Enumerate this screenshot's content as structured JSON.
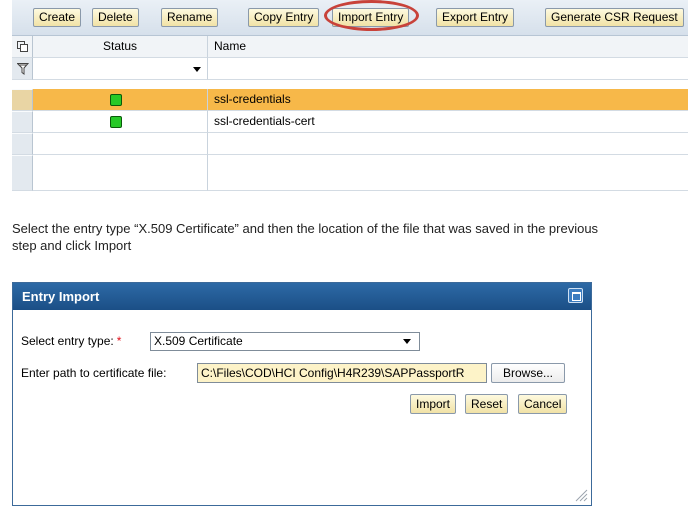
{
  "toolbar": {
    "buttons": [
      {
        "label": "Create"
      },
      {
        "label": "Delete"
      },
      {
        "label": "Rename"
      },
      {
        "label": "Copy Entry"
      },
      {
        "label": "Import Entry",
        "highlighted": true
      },
      {
        "label": "Export Entry"
      },
      {
        "label": "Generate CSR Request"
      }
    ],
    "highlight_color": "#c8423a"
  },
  "table": {
    "columns": {
      "status": "Status",
      "name": "Name"
    },
    "filter_icon": "filter-icon",
    "settings_icon": "table-settings-icon",
    "rows": [
      {
        "status": "green",
        "name": "ssl-credentials",
        "selected": true
      },
      {
        "status": "green",
        "name": "ssl-credentials-cert",
        "selected": false
      }
    ],
    "selected_color": "#f7b849",
    "status_color": "#27c927"
  },
  "instruction": {
    "line1": "Select the entry type “X.509 Certificate” and then the location of the file that was saved in the previous",
    "line2": "step and click Import"
  },
  "dialog": {
    "title": "Entry Import",
    "entry_type_label": "Select entry type:",
    "required_marker": "*",
    "entry_type_value": "X.509 Certificate",
    "path_label": "Enter path to certificate file:",
    "path_value": "C:\\Files\\COD\\HCI Config\\H4R239\\SAPPassportR",
    "browse_label": "Browse...",
    "import_label": "Import",
    "reset_label": "Reset",
    "cancel_label": "Cancel",
    "title_bar_color": "#1f5a94"
  }
}
